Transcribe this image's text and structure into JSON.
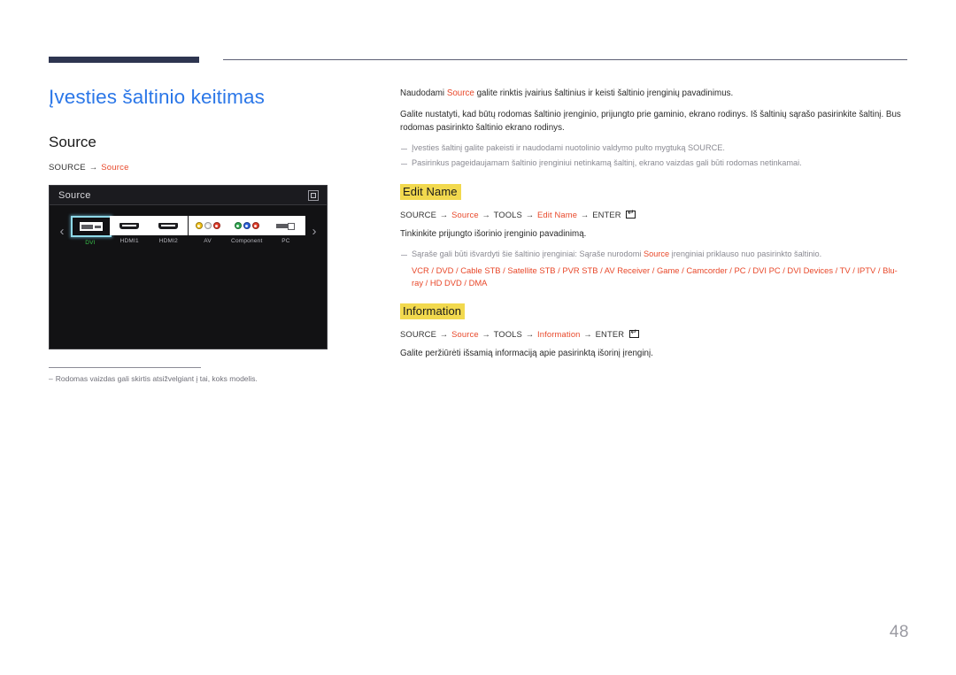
{
  "document": {
    "page_number": "48",
    "page_title": "Įvesties šaltinio keitimas"
  },
  "left": {
    "section_title": "Source",
    "breadcrumb": {
      "root": "SOURCE",
      "arrow": "→",
      "target": "Source"
    },
    "tv_panel": {
      "header_title": "Source",
      "header_icon": "window-icon",
      "prev_arrow": "‹",
      "next_arrow": "›",
      "sources": [
        {
          "label": "DVI",
          "icon": "dvi-connector-icon",
          "selected": true
        },
        {
          "label": "HDMI1",
          "icon": "hdmi-connector-icon",
          "selected": false
        },
        {
          "label": "HDMI2",
          "icon": "hdmi-connector-icon",
          "selected": false
        },
        {
          "label": "AV",
          "icon": "av-rca-connector-icon",
          "selected": false
        },
        {
          "label": "Component",
          "icon": "component-rca-connector-icon",
          "selected": false
        },
        {
          "label": "PC",
          "icon": "pc-vga-connector-icon",
          "selected": false
        }
      ],
      "av_colors": [
        "#f2c21a",
        "#e8e8e8",
        "#e03b28"
      ],
      "component_colors": [
        "#2fa84f",
        "#2b5fd9",
        "#e03b28"
      ]
    },
    "footnote": {
      "dash": "‒",
      "text": "Rodomas vaizdas gali skirtis atsižvelgiant į tai, koks modelis."
    }
  },
  "right": {
    "intro": {
      "p1_pre": "Naudodami ",
      "p1_accent": "Source",
      "p1_post": " galite rinktis įvairius šaltinius ir keisti šaltinio įrenginių pavadinimus.",
      "p2": "Galite nustatyti, kad būtų rodomas šaltinio įrenginio, prijungto prie gaminio, ekrano rodinys. Iš šaltinių sąrašo pasirinkite šaltinį. Bus rodomas pasirinkto šaltinio ekrano rodinys.",
      "note1": "Įvesties šaltinį galite pakeisti ir naudodami nuotolinio valdymo pulto mygtuką SOURCE.",
      "note2": "Pasirinkus pageidaujamam šaltinio įrenginiui netinkamą šaltinį, ekrano vaizdas gali būti rodomas netinkamai."
    },
    "edit_name": {
      "heading": "Edit Name",
      "crumb_1": "SOURCE",
      "crumb_2": "Source",
      "crumb_3": "TOOLS",
      "crumb_4": "Edit Name",
      "crumb_5": "ENTER",
      "arrow": "→",
      "body": "Tinkinkite prijungto išorinio įrenginio pavadinimą.",
      "note_pre": "Sąraše gali būti išvardyti šie šaltinio įrenginiai: Sąraše nurodomi ",
      "note_accent": "Source",
      "note_post": " įrenginiai priklauso nuo pasirinkto šaltinio.",
      "device_list": "VCR / DVD / Cable STB / Satellite STB / PVR STB / AV Receiver / Game / Camcorder / PC / DVI PC / DVI Devices / TV / IPTV / Blu-ray / HD DVD / DMA"
    },
    "information": {
      "heading": "Information",
      "crumb_1": "SOURCE",
      "crumb_2": "Source",
      "crumb_3": "TOOLS",
      "crumb_4": "Information",
      "crumb_5": "ENTER",
      "arrow": "→",
      "body": "Galite peržiūrėti išsamią informaciją apie pasirinktą išorinį įrenginį."
    }
  },
  "colors": {
    "accent_red": "#e8482a",
    "title_blue": "#2b77e8",
    "highlight_yellow": "#f2d94e",
    "rule_dark": "#2e3550",
    "selected_green": "#39c24a",
    "selection_border": "#8fd9e8"
  }
}
